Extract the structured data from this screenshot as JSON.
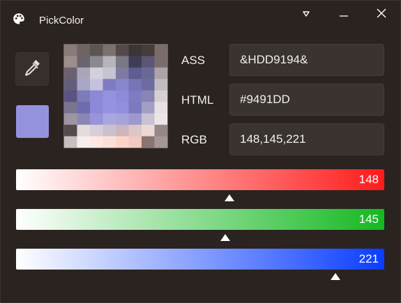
{
  "window": {
    "title": "PickColor",
    "icons": {
      "app": "palette-icon",
      "dropdown": "triangle-down-icon",
      "minimize": "minimize-icon",
      "close": "close-icon",
      "picker": "eyedropper-icon"
    }
  },
  "color": {
    "swatch": "#9491DD",
    "fields": [
      {
        "label": "ASS",
        "value": "&HDD9194&"
      },
      {
        "label": "HTML",
        "value": "#9491DD"
      },
      {
        "label": "RGB",
        "value": "148,145,221"
      }
    ]
  },
  "sliders": [
    {
      "channel": "red",
      "value": 148,
      "max": 255,
      "gradient_from": "#ffffff",
      "gradient_to": "#ff1a1a"
    },
    {
      "channel": "green",
      "value": 145,
      "max": 255,
      "gradient_from": "#ffffff",
      "gradient_to": "#14b820"
    },
    {
      "channel": "blue",
      "value": 221,
      "max": 255,
      "gradient_from": "#ffffff",
      "gradient_to": "#0a3cff"
    }
  ],
  "magnifier": {
    "pixels": [
      [
        "#8a7a78",
        "#6e6461",
        "#5d5552",
        "#7b716e",
        "#55494a",
        "#3c3536",
        "#453c3b",
        "#7a6c68"
      ],
      [
        "#9c8e8b",
        "#6b6470",
        "#8a8890",
        "#b7b5ba",
        "#7b7886",
        "#3f3d55",
        "#5c5675",
        "#7a6d70"
      ],
      [
        "#6a6270",
        "#a9a6bb",
        "#d3d0dc",
        "#c7c4d1",
        "#7d7aa4",
        "#5f5c92",
        "#6b6895",
        "#aba3a8"
      ],
      [
        "#655e7b",
        "#a9a7c8",
        "#c5c3dc",
        "#7e7bc1",
        "#8886ce",
        "#7775b6",
        "#6e6ba2",
        "#c2bcc0"
      ],
      [
        "#5a5480",
        "#7e7bb8",
        "#8c89d6",
        "#9491dd",
        "#8e8bd9",
        "#7e7bc4",
        "#8884b6",
        "#d7d0d3"
      ],
      [
        "#7a748e",
        "#6e6bb0",
        "#8c89d8",
        "#9592e0",
        "#918ede",
        "#7c79c0",
        "#a29fc2",
        "#e8e0e2"
      ],
      [
        "#9d95a4",
        "#8a87b4",
        "#9794d8",
        "#aaa7df",
        "#a6a3db",
        "#9c99cf",
        "#c8c2d4",
        "#ede5e6"
      ],
      [
        "#564b4c",
        "#e4dbde",
        "#d7ced8",
        "#c9c1cf",
        "#cbb6bc",
        "#dcc6c6",
        "#ecd9d6",
        "#938788"
      ],
      [
        "#c8c0c0",
        "#f6eeee",
        "#fde8e2",
        "#fbe0d9",
        "#fdd5c8",
        "#f3cabf",
        "#8a7471",
        "#a39897"
      ]
    ]
  }
}
